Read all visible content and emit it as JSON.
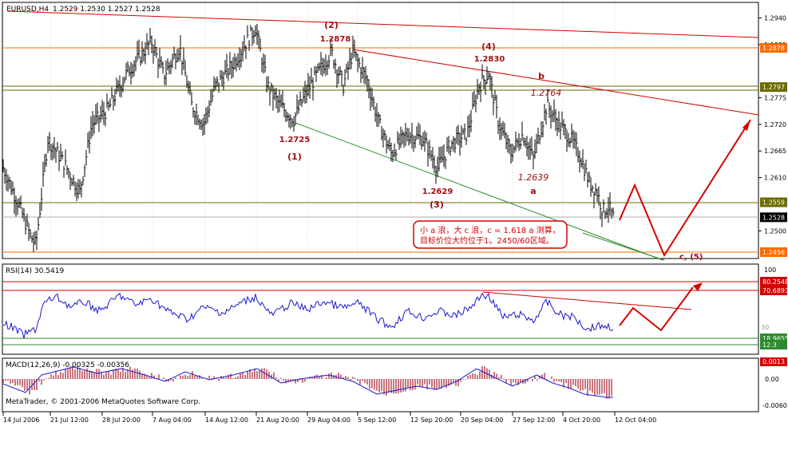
{
  "colors": {
    "grid": "#000000",
    "bar": "#000000",
    "rsi_line": "#1a1acc",
    "macd_line": "#1a1acc",
    "macd_hist": "#b23a48",
    "red": "#d40000",
    "orange": "#ff6a00",
    "olive": "#6b6b00",
    "green": "#2e8b2e",
    "dark_red_text": "#a01010"
  },
  "main_chart": {
    "title": "EURUSD,H4",
    "ohlc": "1.2529 1.2530 1.2527 1.2528",
    "y_ticks": [
      "1.2940",
      "1.2885",
      "1.2775",
      "1.2720",
      "1.2665",
      "1.2610",
      "1.2500"
    ],
    "level_labels": [
      {
        "text": "1.2878",
        "bg": "#ff6a00",
        "fg": "#ffffff",
        "y": 1.2878
      },
      {
        "text": "1.2797",
        "bg": "#6b6b00",
        "fg": "#ffffff",
        "y": 1.2797
      },
      {
        "text": "1.2559",
        "bg": "#6b6b00",
        "fg": "#ffffff",
        "y": 1.2559
      },
      {
        "text": "1.2528",
        "bg": "#000000",
        "fg": "#ffffff",
        "y": 1.2528
      },
      {
        "text": "1.2456",
        "bg": "#ff6a00",
        "fg": "#ffffff",
        "y": 1.2456
      }
    ],
    "annotations": [
      {
        "text": "(2)",
        "kind": "wave"
      },
      {
        "text": "1.2878",
        "kind": "price"
      },
      {
        "text": "(4)",
        "kind": "wave"
      },
      {
        "text": "1.2830",
        "kind": "price"
      },
      {
        "text": "b",
        "kind": "wave"
      },
      {
        "text": "1.2764",
        "kind": "italic"
      },
      {
        "text": "1.2725",
        "kind": "price"
      },
      {
        "text": "(1)",
        "kind": "wave"
      },
      {
        "text": "1.2639",
        "kind": "italic"
      },
      {
        "text": "a",
        "kind": "wave"
      },
      {
        "text": "1.2629",
        "kind": "price"
      },
      {
        "text": "(3)",
        "kind": "wave"
      },
      {
        "text": "c, (5)",
        "kind": "wave"
      }
    ],
    "note_lines": [
      "小 a 浪，大 c 浪，c = 1.618 a 测算，",
      "目标价位大约位于1。2450/60区域。"
    ]
  },
  "rsi": {
    "label": "RSI(14) 30.5419",
    "y_ticks": [
      "100",
      "30"
    ],
    "level_labels": [
      {
        "text": "80.2548",
        "bg": "#d40000"
      },
      {
        "text": "70.6893",
        "bg": "#d40000"
      },
      {
        "text": "18.9655",
        "bg": "#2e8b2e"
      },
      {
        "text": "12.3",
        "bg": "#2e8b2e"
      }
    ]
  },
  "macd": {
    "label": "MACD(12,26,9) -0.00325 -0.00356",
    "y_ticks": [
      "0.0013",
      "0.00",
      "-0.0060"
    ]
  },
  "watermark": "MetaTrader, © 2001-2006 MetaQuotes Software Corp.",
  "x_axis": [
    "14 Jul 2006",
    "21 Jul 12:00",
    "28 Jul 20:00",
    "7 Aug 04:00",
    "14 Aug 12:00",
    "21 Aug 20:00",
    "29 Aug 04:00",
    "5 Sep 12:00",
    "12 Sep 20:00",
    "20 Sep 04:00",
    "27 Sep 12:00",
    "4 Oct 20:00",
    "12 Oct 04:00"
  ]
}
